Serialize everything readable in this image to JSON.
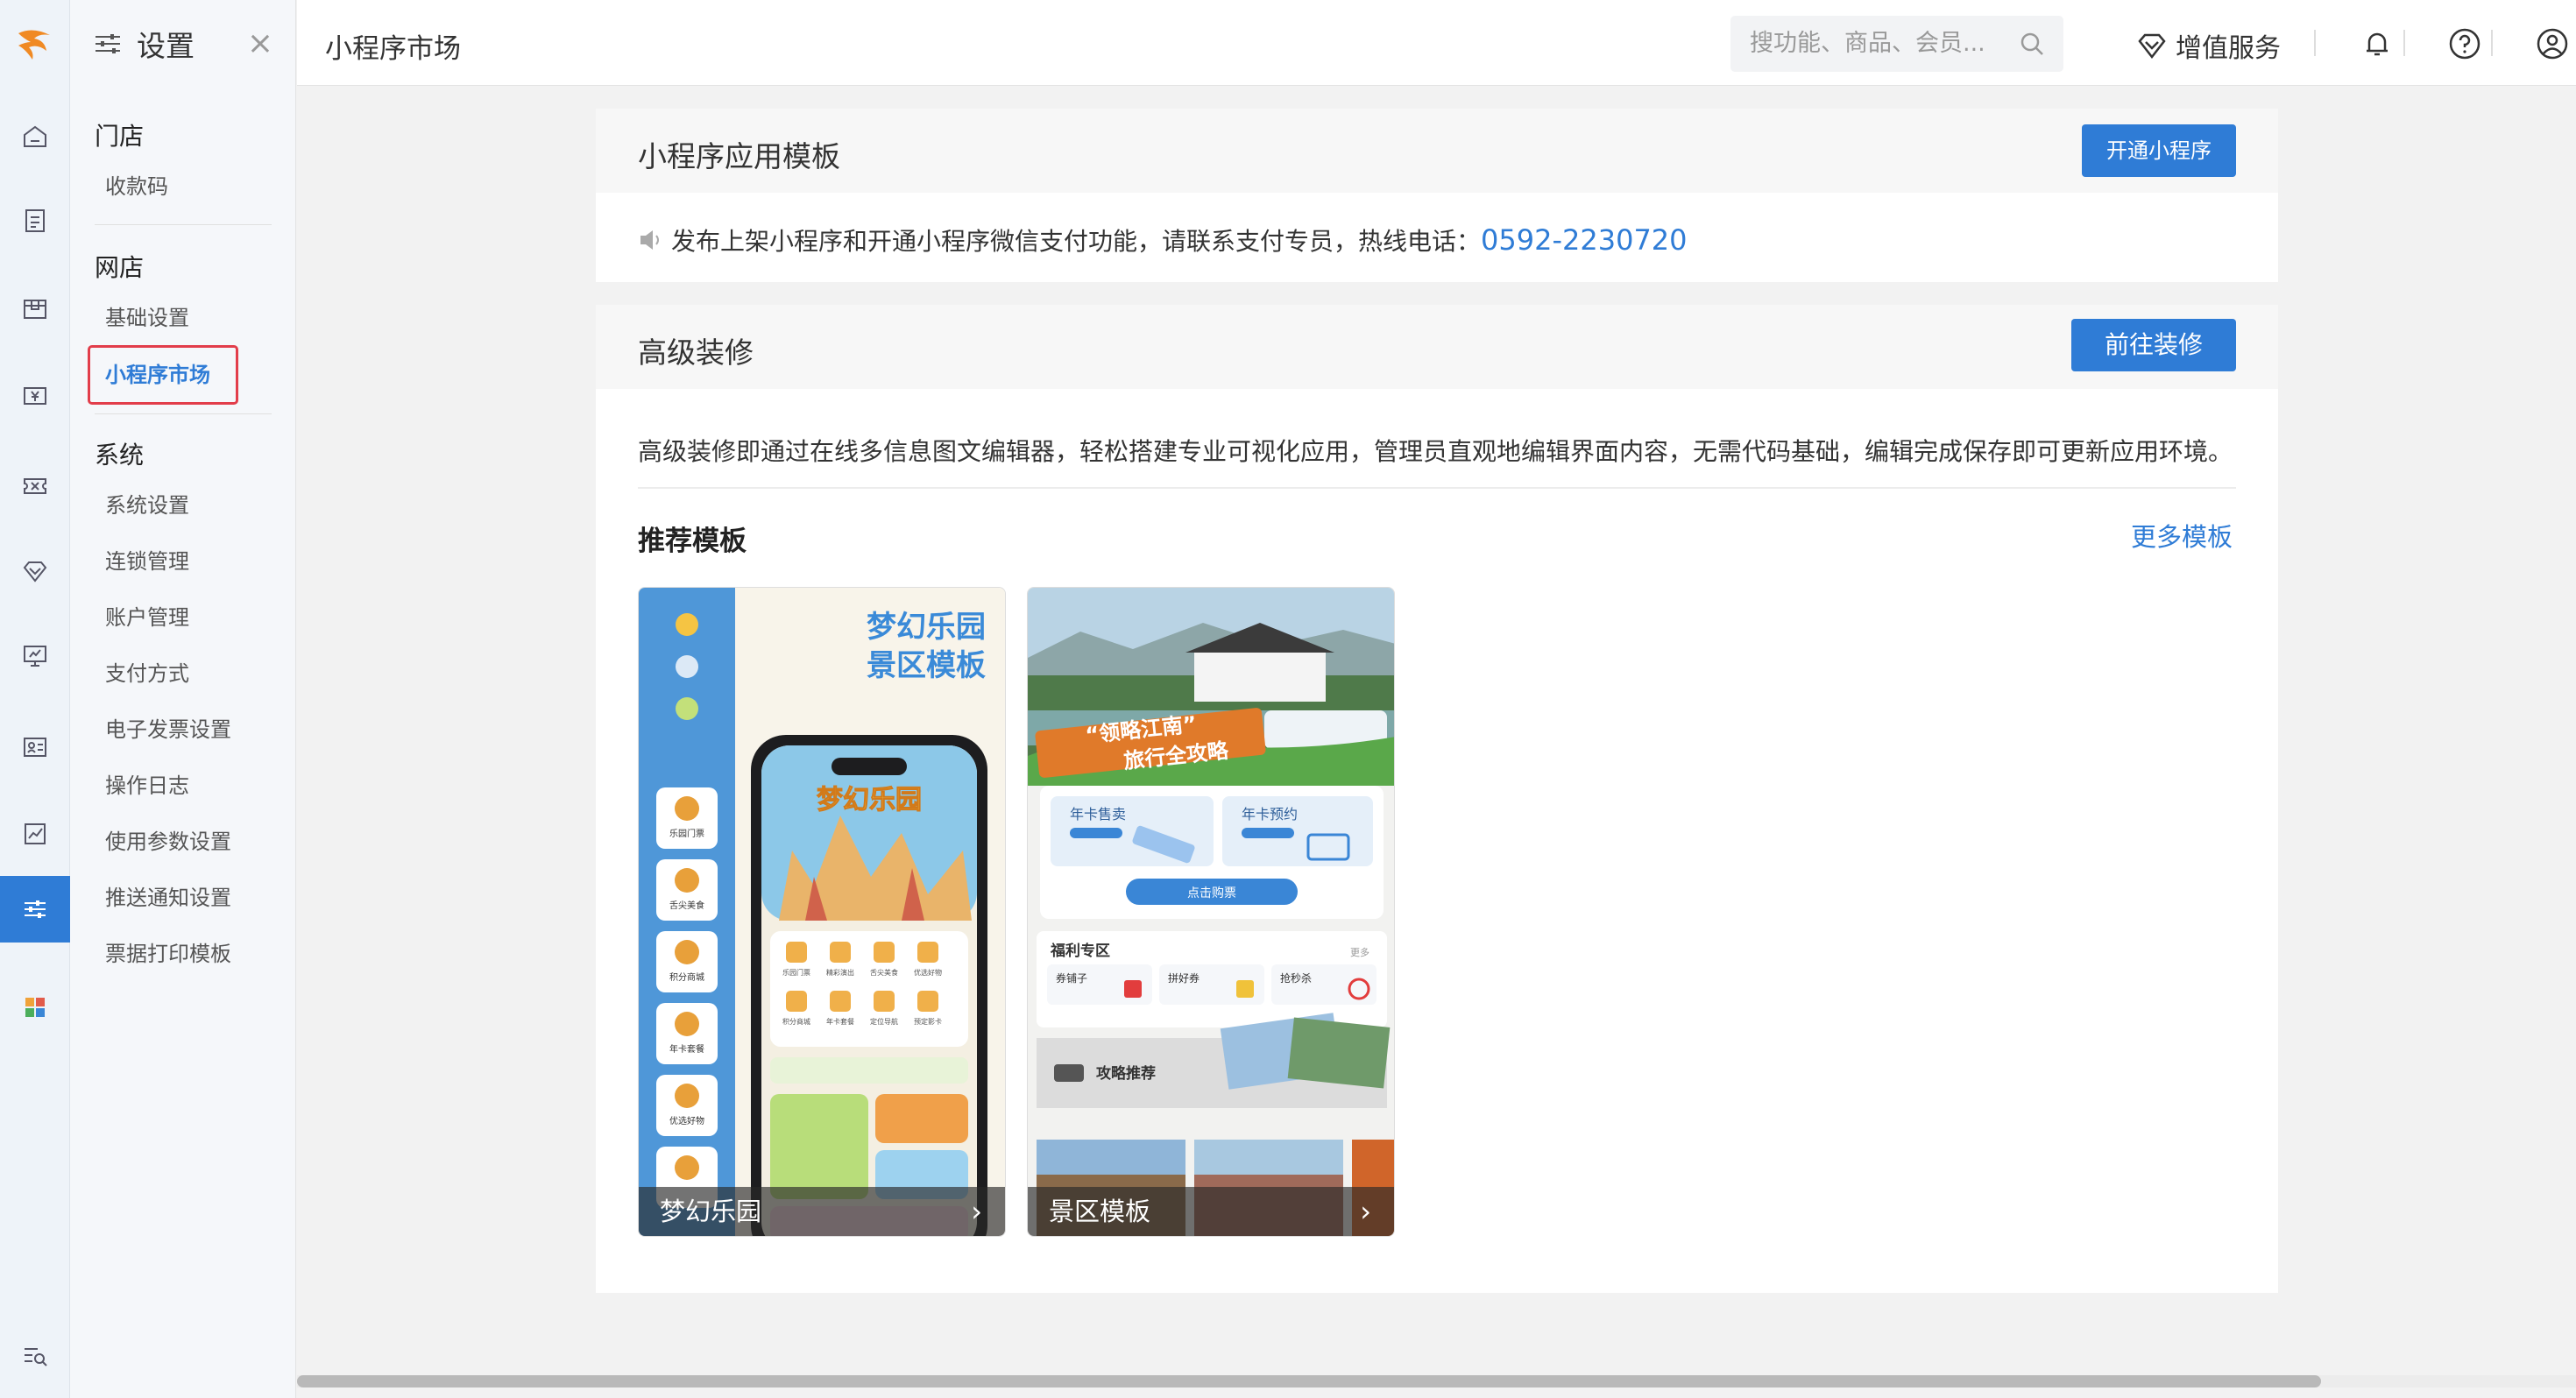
{
  "sidebar": {
    "title": "设置",
    "close": "×",
    "groups": [
      {
        "label": "门店",
        "items": [
          "收款码"
        ]
      },
      {
        "label": "网店",
        "items": [
          "基础设置",
          "小程序市场"
        ]
      },
      {
        "label": "系统",
        "items": [
          "系统设置",
          "连锁管理",
          "账户管理",
          "支付方式",
          "电子发票设置",
          "操作日志",
          "使用参数设置",
          "推送通知设置",
          "票据打印模板"
        ]
      }
    ],
    "selected": "小程序市场"
  },
  "rail": {
    "icons": [
      "logo-icon",
      "home-icon",
      "report-icon",
      "product-icon",
      "finance-icon",
      "ticket-icon",
      "vip-icon",
      "monitor-icon",
      "member-card-icon",
      "analytics-icon",
      "settings-icon",
      "apps-icon",
      "search-list-icon"
    ],
    "active": "settings-icon"
  },
  "topbar": {
    "title": "小程序市场",
    "search_placeholder": "搜功能、商品、会员...",
    "vip_label": "增值服务"
  },
  "template_card": {
    "title": "小程序应用模板",
    "open_button": "开通小程序",
    "notice": "发布上架小程序和开通小程序微信支付功能，请联系支付专员，热线电话：",
    "phone": "0592-2230720"
  },
  "decor_card": {
    "title": "高级装修",
    "go_button": "前往装修",
    "description": "高级装修即通过在线多信息图文编辑器，轻松搭建专业可视化应用，管理员直观地编辑界面内容，无需代码基础，编辑完成保存即可更新应用环境。",
    "recommend_title": "推荐模板",
    "more_label": "更多模板",
    "templates": [
      {
        "name": "梦幻乐园",
        "heading_line1": "梦幻乐园",
        "heading_line2": "景区模板",
        "phone_title": "梦幻乐园",
        "side_items": [
          "乐园门票",
          "舌尖美食",
          "积分商城",
          "年卡套餐",
          "优选好物"
        ],
        "grid_items": [
          "乐园门票",
          "精彩演出",
          "舌尖美食",
          "优选好物",
          "积分商城",
          "年卡套餐",
          "定位导航",
          "预定影卡"
        ]
      },
      {
        "name": "景区模板",
        "banner_text_1": "“领略江南”",
        "banner_text_2": "旅行全攻略",
        "tile1": "年卡售卖",
        "tile2": "年卡预约",
        "buy_button": "点击购票",
        "welfare": "福利专区",
        "welfare_more": "更多",
        "welfare_items": [
          "券铺子",
          "拼好券",
          "抢秒杀"
        ],
        "guide": "攻略推荐"
      }
    ]
  },
  "colors": {
    "accent": "#2f7cd6",
    "highlight": "#e23d4a"
  }
}
